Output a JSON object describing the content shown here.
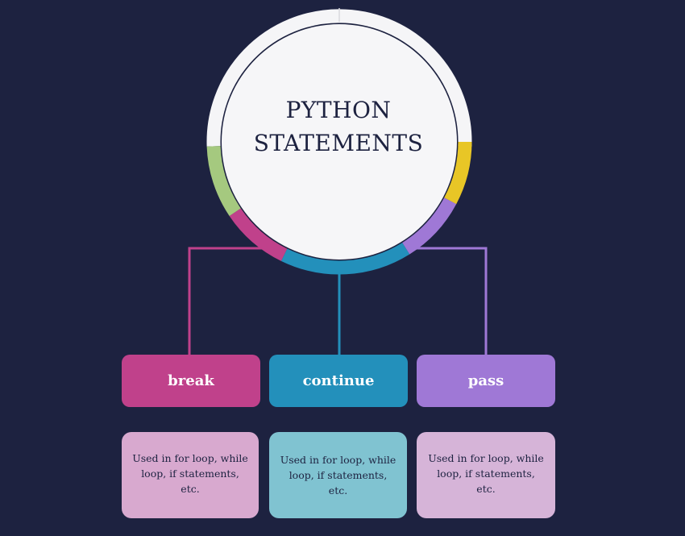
{
  "diagram": {
    "title_lines": [
      "PYTHON",
      "STATEMENTS"
    ],
    "branches": [
      {
        "label": "break",
        "color": "#c0418b",
        "desc_color": "#d8a9cf",
        "desc_lines": [
          "Used in for loop, while",
          "loop, if statements, etc."
        ]
      },
      {
        "label": "continue",
        "color": "#2390bb",
        "desc_color": "#80c3d1",
        "desc_lines": [
          "Used in for loop, while",
          "loop, if statements, etc."
        ]
      },
      {
        "label": "pass",
        "color": "#9f78d6",
        "desc_color": "#d6b4d8",
        "desc_lines": [
          "Used in for loop, while",
          "loop, if statements, etc."
        ]
      }
    ],
    "ring_colors": {
      "white": "#f5f5f7",
      "yellow": "#e8c626",
      "purple": "#9f78d6",
      "blue": "#2390bb",
      "pink": "#c0418b",
      "green": "#a5c97f"
    }
  }
}
